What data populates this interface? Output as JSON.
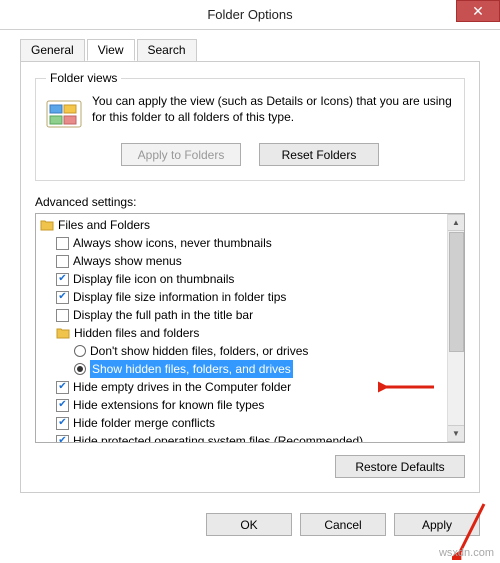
{
  "title": "Folder Options",
  "close_glyph": "✕",
  "tabs": {
    "general": "General",
    "view": "View",
    "search": "Search"
  },
  "folder_views": {
    "legend": "Folder views",
    "desc": "You can apply the view (such as Details or Icons) that you are using for this folder to all folders of this type.",
    "apply_btn": "Apply to Folders",
    "reset_btn": "Reset Folders"
  },
  "advanced_label": "Advanced settings:",
  "tree": {
    "root": "Files and Folders",
    "i0": "Always show icons, never thumbnails",
    "i1": "Always show menus",
    "i2": "Display file icon on thumbnails",
    "i3": "Display file size information in folder tips",
    "i4": "Display the full path in the title bar",
    "hidden_header": "Hidden files and folders",
    "r0": "Don't show hidden files, folders, or drives",
    "r1": "Show hidden files, folders, and drives",
    "i5": "Hide empty drives in the Computer folder",
    "i6": "Hide extensions for known file types",
    "i7": "Hide folder merge conflicts",
    "i8": "Hide protected operating system files (Recommended)"
  },
  "checked": {
    "i0": false,
    "i1": false,
    "i2": true,
    "i3": true,
    "i4": false,
    "i5": true,
    "i6": true,
    "i7": true,
    "i8": true
  },
  "radio_selected": "r1",
  "restore_btn": "Restore Defaults",
  "buttons": {
    "ok": "OK",
    "cancel": "Cancel",
    "apply": "Apply"
  },
  "watermark": "wsxdn.com"
}
